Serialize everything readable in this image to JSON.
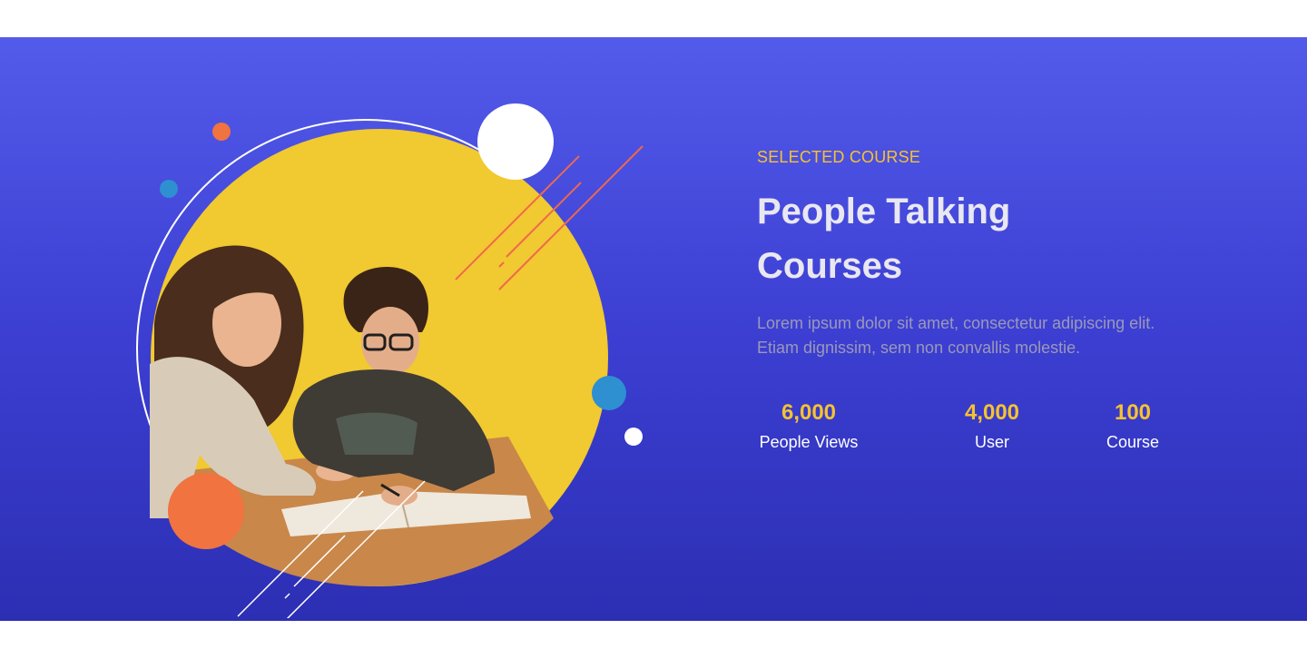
{
  "section": {
    "eyebrow": "SELECTED COURSE",
    "title": "People Talking Courses",
    "description": "Lorem ipsum dolor sit amet, consectetur adipiscing elit. Etiam dignissim, sem non convallis molestie."
  },
  "stats": [
    {
      "value": "6,000",
      "label": "People Views"
    },
    {
      "value": "4,000",
      "label": "User"
    },
    {
      "value": "100",
      "label": "Course"
    }
  ],
  "colors": {
    "accent_yellow": "#f5c232",
    "accent_orange": "#f07340",
    "accent_blue": "#2e8fd1",
    "band_top": "#535bea",
    "band_bottom": "#2c2fb3"
  },
  "illustration": {
    "icon": "students-studying-image"
  }
}
